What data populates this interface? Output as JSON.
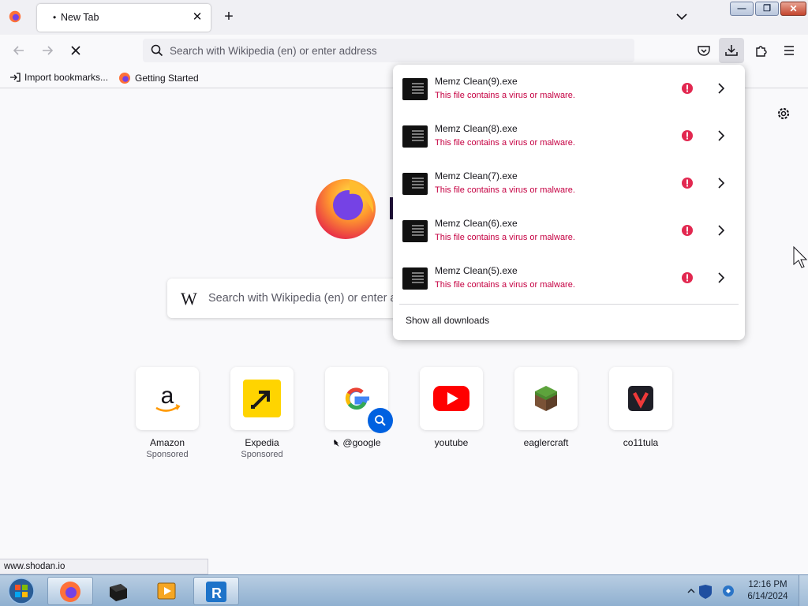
{
  "tabstrip": {
    "tab_title": "New Tab",
    "tab_close": "✕",
    "new_tab": "+",
    "window_controls": {
      "minimize": "—",
      "maximize": "❐",
      "close": "✕"
    }
  },
  "navbar": {
    "url_placeholder": "Search with Wikipedia (en) or enter address",
    "icons": [
      "back-arrow-icon",
      "forward-arrow-icon",
      "stop-loading-icon",
      "pocket-icon",
      "downloads-icon",
      "extensions-icon",
      "hamburger-menu-icon"
    ]
  },
  "bookmarks": {
    "items": [
      {
        "label": "Import bookmarks...",
        "icon": "import-icon"
      },
      {
        "label": "Getting Started",
        "icon": "firefox-icon"
      }
    ]
  },
  "newtab": {
    "search_w": "W",
    "search_placeholder": "Search with Wikipedia (en) or enter address",
    "shortcuts": [
      {
        "label": "Amazon",
        "sub": "Sponsored",
        "icon": "amazon-icon"
      },
      {
        "label": "Expedia",
        "sub": "Sponsored",
        "icon": "expedia-icon"
      },
      {
        "label": "@google",
        "sub": "",
        "icon": "google-icon"
      },
      {
        "label": "youtube",
        "sub": "",
        "icon": "youtube-icon"
      },
      {
        "label": "eaglercraft",
        "sub": "",
        "icon": "grass-block-icon"
      },
      {
        "label": "co11tula",
        "sub": "",
        "icon": "vivaldi-v-icon"
      }
    ]
  },
  "downloads": {
    "items": [
      {
        "name": "Memz Clean(9).exe",
        "status": "This file contains a virus or malware."
      },
      {
        "name": "Memz Clean(8).exe",
        "status": "This file contains a virus or malware."
      },
      {
        "name": "Memz Clean(7).exe",
        "status": "This file contains a virus or malware."
      },
      {
        "name": "Memz Clean(6).exe",
        "status": "This file contains a virus or malware."
      },
      {
        "name": "Memz Clean(5).exe",
        "status": "This file contains a virus or malware."
      }
    ],
    "show_all": "Show all downloads"
  },
  "status_bar": {
    "url": "www.shodan.io"
  },
  "taskbar": {
    "apps": [
      "firefox-icon",
      "terminal-box-icon",
      "media-player-icon",
      "vscode-like-icon"
    ],
    "time": "12:16 PM",
    "date": "6/14/2024"
  },
  "colors": {
    "malware_red": "#c50042",
    "accent_blue": "#0061e0"
  }
}
